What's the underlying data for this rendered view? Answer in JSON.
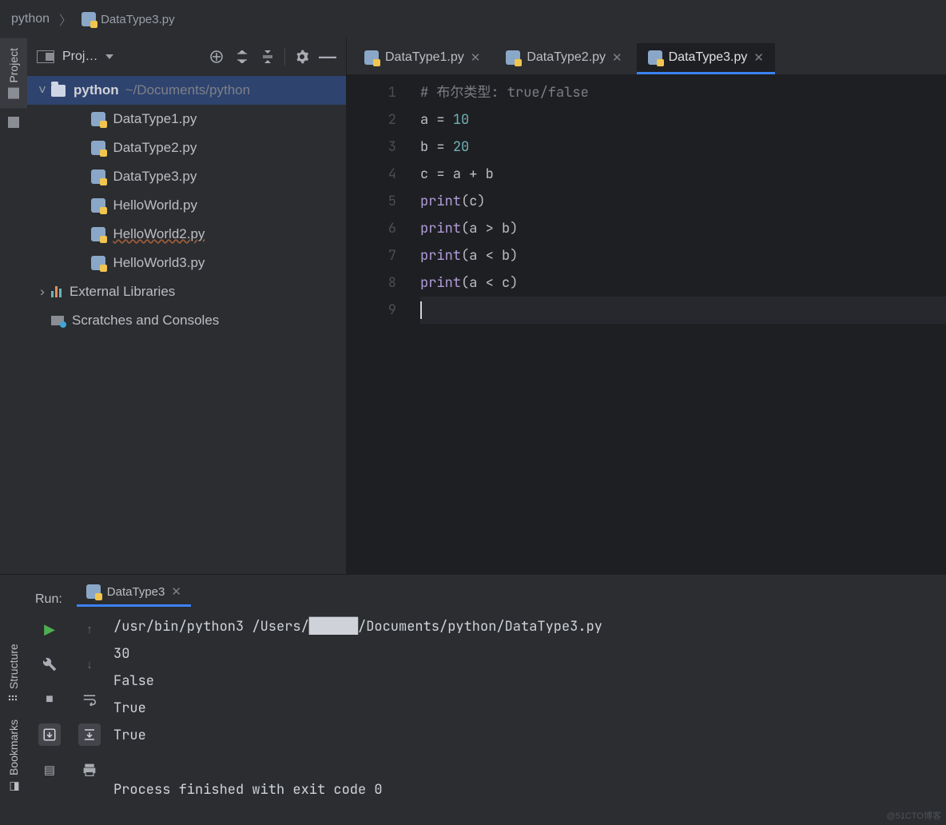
{
  "breadcrumb": {
    "root": "python",
    "file": "DataType3.py"
  },
  "sidebar_tabs": {
    "project": "Project"
  },
  "project_header": {
    "label": "Proj…"
  },
  "tree": {
    "root_name": "python",
    "root_path": "~/Documents/python",
    "files": [
      {
        "name": "DataType1.py",
        "squiggle": false
      },
      {
        "name": "DataType2.py",
        "squiggle": false
      },
      {
        "name": "DataType3.py",
        "squiggle": false
      },
      {
        "name": "HelloWorld.py",
        "squiggle": false
      },
      {
        "name": "HelloWorld2.py",
        "squiggle": true
      },
      {
        "name": "HelloWorld3.py",
        "squiggle": false
      }
    ],
    "ext_lib": "External Libraries",
    "scratches": "Scratches and Consoles"
  },
  "editor_tabs": [
    {
      "label": "DataType1.py",
      "active": false
    },
    {
      "label": "DataType2.py",
      "active": false
    },
    {
      "label": "DataType3.py",
      "active": true
    }
  ],
  "code": {
    "lines": [
      {
        "n": "1",
        "html": "<span class='cmt'># 布尔类型: true/false</span>"
      },
      {
        "n": "2",
        "html": "a <span class='op'>=</span> <span class='num'>10</span>"
      },
      {
        "n": "3",
        "html": "b <span class='op'>=</span> <span class='num'>20</span>"
      },
      {
        "n": "4",
        "html": "c <span class='op'>=</span> a <span class='op'>+</span> b"
      },
      {
        "n": "5",
        "html": "<span class='fn'>print</span>(c)"
      },
      {
        "n": "6",
        "html": "<span class='fn'>print</span>(a &gt; b)"
      },
      {
        "n": "7",
        "html": "<span class='fn'>print</span>(a &lt; b)"
      },
      {
        "n": "8",
        "html": "<span class='fn'>print</span>(a &lt; c)"
      },
      {
        "n": "9",
        "html": "<span class='caret'></span>"
      }
    ]
  },
  "run": {
    "label": "Run:",
    "tab": "DataType3",
    "output_lines": [
      "/usr/bin/python3 /Users/██████/Documents/python/DataType3.py",
      "30",
      "False",
      "True",
      "True",
      "",
      "Process finished with exit code 0"
    ]
  },
  "left2_tabs": {
    "structure": "Structure",
    "bookmarks": "Bookmarks"
  },
  "watermark": "@51CTO博客"
}
